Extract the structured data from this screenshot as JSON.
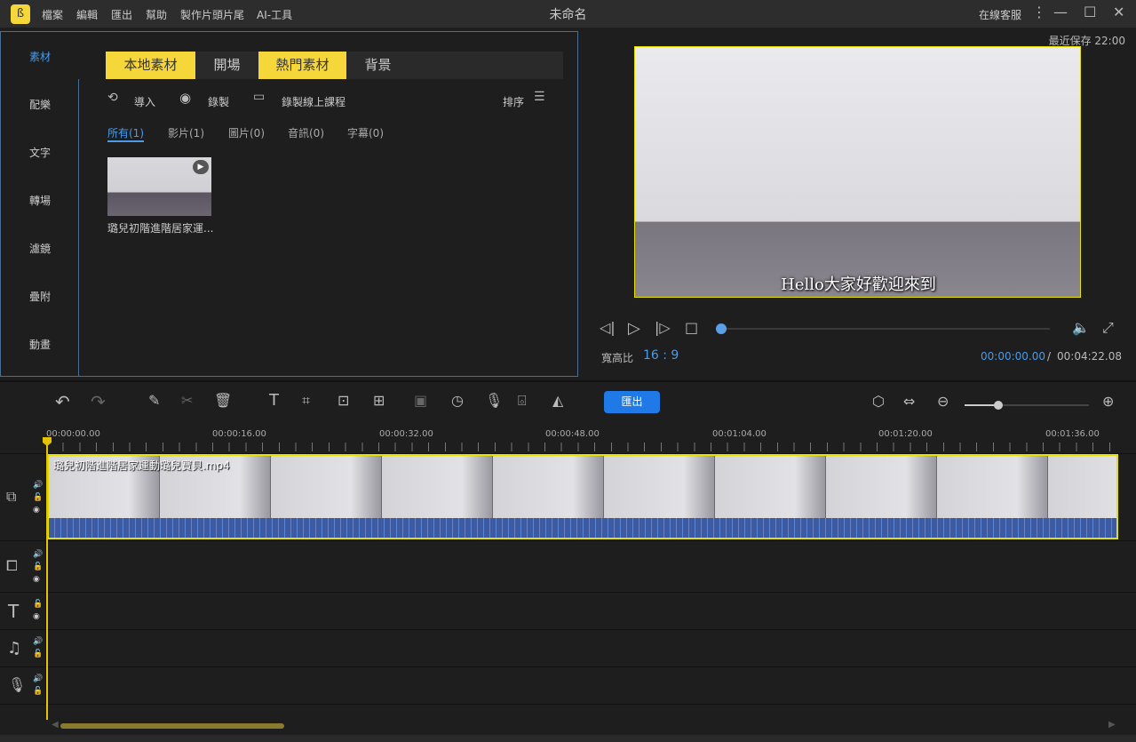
{
  "titlebar": {
    "app_title": "未命名",
    "menu": [
      "檔案",
      "編輯",
      "匯出",
      "幫助",
      "製作片頭片尾",
      "AI-工具"
    ],
    "support": "在線客服"
  },
  "sidebar": [
    "素材",
    "配樂",
    "文字",
    "轉場",
    "濾鏡",
    "疊附",
    "動畫"
  ],
  "tabs": [
    {
      "label": "本地素材",
      "active": true
    },
    {
      "label": "開場",
      "active": false
    },
    {
      "label": "熱門素材",
      "active": true
    },
    {
      "label": "背景",
      "active": false
    }
  ],
  "tools": {
    "import": "導入",
    "record": "錄製",
    "record_course": "錄製線上課程",
    "sort": "排序"
  },
  "filters": [
    "所有(1)",
    "影片(1)",
    "圖片(0)",
    "音訊(0)",
    "字幕(0)"
  ],
  "media": [
    {
      "name": "璐兒初階進階居家運..."
    }
  ],
  "preview": {
    "saved": "最近保存 22:00",
    "subtitle": "Hello大家好歡迎來到",
    "aspect_label": "寬高比",
    "aspect": "16 : 9",
    "current": "00:00:00.00",
    "separator": "/",
    "total": "00:04:22.08",
    "progress": 0
  },
  "timeline": {
    "export": "匯出",
    "ticks": [
      "00:00:00.00",
      "00:00:16.00",
      "00:00:32.00",
      "00:00:48.00",
      "00:01:04.00",
      "00:01:20.00",
      "00:01:36.00"
    ],
    "clip_name": "璐兒初階進階居家運動璐兒寶貝.mp4",
    "zoom_level": 0.27
  },
  "colors": {
    "accent": "#f5d73a",
    "export": "#1f7ae8",
    "time": "#4a9be8"
  }
}
